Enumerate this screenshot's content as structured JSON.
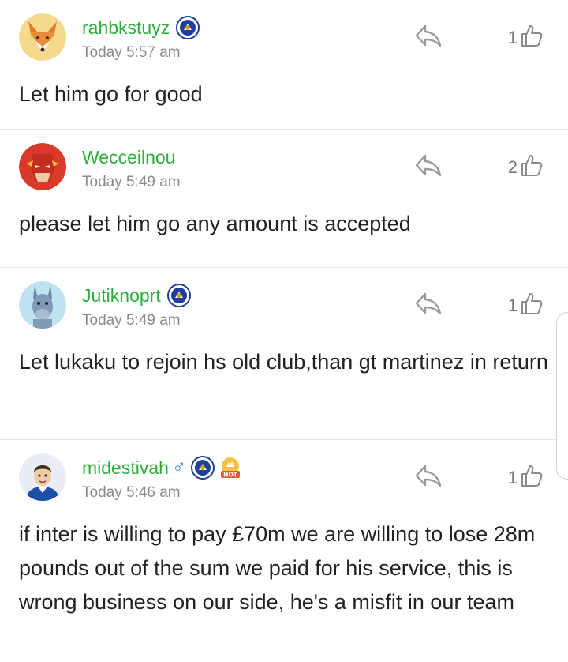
{
  "comments": [
    {
      "username": "rahbkstuyz",
      "time": "Today 5:57 am",
      "likes": "1",
      "text": "Let him go for good",
      "avatar_icon": "fox-avatar-icon",
      "badges": [
        "chelsea-badge-icon"
      ]
    },
    {
      "username": "Wecceilnou",
      "time": "Today 5:49 am",
      "likes": "2",
      "text": "please let him go any amount is accepted",
      "avatar_icon": "flash-avatar-icon",
      "badges": []
    },
    {
      "username": "Jutiknoprt",
      "time": "Today 5:49 am",
      "likes": "1",
      "text": "Let lukaku to rejoin hs old club,than gt martinez in return",
      "avatar_icon": "donkey-avatar-icon",
      "badges": [
        "chelsea-badge-icon"
      ]
    },
    {
      "username": "midestivah",
      "gender_symbol": "♂",
      "time": "Today 5:46 am",
      "likes": "1",
      "text": "if inter is willing to pay £70m we are willing to lose 28m pounds out of the sum we paid for his service, this is wrong business on our side, he's a misfit in our team",
      "avatar_icon": "player-avatar-icon",
      "badges": [
        "chelsea-badge-icon",
        "hot-badge-icon"
      ],
      "hot_label": "HOT"
    }
  ],
  "colors": {
    "username": "#2fae3b",
    "time": "#8a8a8a",
    "text": "#222222",
    "icon": "#9a9a9a",
    "chelsea_blue": "#1f3f9a"
  }
}
